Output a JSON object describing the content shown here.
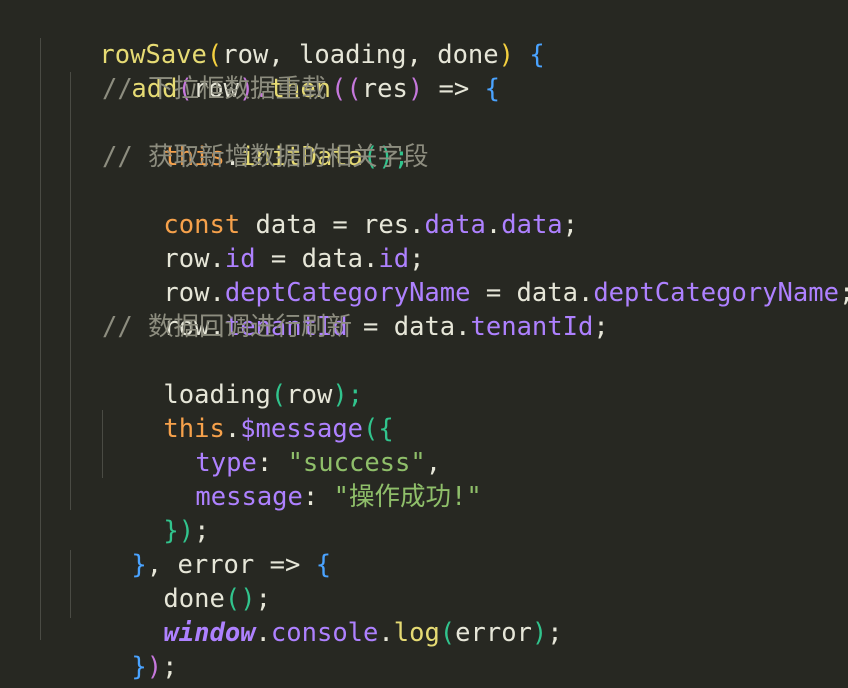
{
  "code": {
    "line1": [
      "rowSave",
      "(",
      "row",
      ", ",
      "loading",
      ", ",
      "done",
      ") ",
      "{"
    ],
    "line2": [
      "add",
      "(",
      "row",
      ").",
      "then",
      "((",
      "res",
      ") ",
      "=>",
      " ",
      "{"
    ],
    "line3": "// 下拉框数据重载",
    "line4": [
      "this",
      ".",
      "initData",
      "();"
    ],
    "line5": "// 获取新增数据的相关字段",
    "line6": [
      "const",
      " data ",
      "=",
      " res",
      ".",
      "data",
      ".",
      "data",
      ";"
    ],
    "line7": [
      "row",
      ".",
      "id",
      " = ",
      "data",
      ".",
      "id",
      ";"
    ],
    "line8": [
      "row",
      ".",
      "deptCategoryName",
      " = ",
      "data",
      ".",
      "deptCategoryName",
      ";"
    ],
    "line9": [
      "row",
      ".",
      "tenantId",
      " = ",
      "data",
      ".",
      "tenantId",
      ";"
    ],
    "line10": "// 数据回调进行刷新",
    "line11": [
      "loading",
      "(",
      "row",
      ");"
    ],
    "line12": [
      "this",
      ".",
      "$message",
      "(",
      "{"
    ],
    "line13": [
      "type",
      ": ",
      "\"success\"",
      ","
    ],
    "line14": [
      "message",
      ": ",
      "\"操作成功!\""
    ],
    "line15": [
      "}",
      ")",
      ";"
    ],
    "line16": [
      "}",
      ", ",
      "error",
      " => ",
      "{"
    ],
    "line17": [
      "done",
      "()",
      ";"
    ],
    "line18": [
      "window",
      ".",
      "console",
      ".",
      "log",
      "(",
      "error",
      ")",
      ";"
    ],
    "line19": [
      "}",
      ")",
      ";"
    ],
    "line20": [
      "}",
      ","
    ]
  },
  "colors": {
    "background": "#272822",
    "function": "#e6db74",
    "keyword": "#f6a14b",
    "property": "#ae81ff",
    "string": "#8fbf6a",
    "comment": "#8d8d7f"
  }
}
